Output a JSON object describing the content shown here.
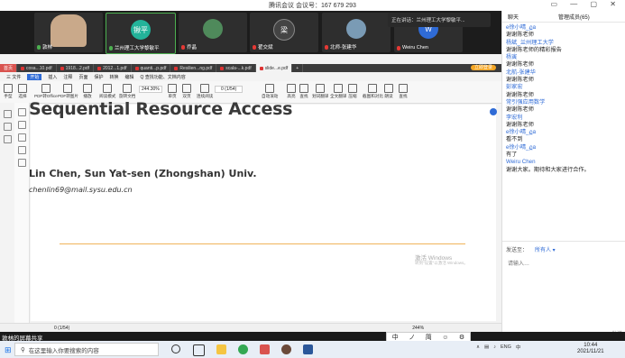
{
  "meeting": {
    "title": "腾讯会议 会议号：167 679 293",
    "speaking": "正在讲话：兰州理工大学黎敏平...",
    "participants": [
      {
        "name": "敦林",
        "avatar": "",
        "color": "#8a6b55"
      },
      {
        "name": "兰州理工大学黎敏平",
        "avatar": "锹平",
        "color": "#23b39a"
      },
      {
        "name": "乔晶",
        "avatar": "",
        "color": "#4f8a5b"
      },
      {
        "name": "翟交斌",
        "avatar": "梁",
        "color": "#444444"
      },
      {
        "name": "北师-张建华",
        "avatar": "",
        "color": "#7a9bb5"
      },
      {
        "name": "Weiru Chen",
        "avatar": "W",
        "color": "#2f6bd6"
      }
    ]
  },
  "chat": {
    "tab_chat": "聊天",
    "tab_manage": "管理成员(65)",
    "messages": [
      {
        "sender": "e徐小晴_ฏอ",
        "text": "谢谢陈老师"
      },
      {
        "sender": "杨斌_兰州理工大学",
        "text": "谢谢陈老师的精彩报告"
      },
      {
        "sender": "杨寅",
        "text": "谢谢陈老师"
      },
      {
        "sender": "北航-张建华",
        "text": "谢谢陈老师"
      },
      {
        "sender": "彭家宏",
        "text": "谢谢陈老师"
      },
      {
        "sender": "常引强应用数学",
        "text": "谢谢陈老师"
      },
      {
        "sender": "李宏利",
        "text": "谢谢陈老师"
      },
      {
        "sender": "e徐小晴_ฏอ",
        "text": "看不到"
      },
      {
        "sender": "e徐小晴_ฏอ",
        "text": "有了"
      },
      {
        "sender": "Weiru Chen",
        "text": "谢谢大家。期待和大家进行合作。"
      }
    ],
    "send_to_label": "发送至：",
    "send_to_value": "所有人 ▾",
    "input_placeholder": "请输入…",
    "send_label": "发送"
  },
  "wps": {
    "tabs": [
      "首页",
      "cosa...10.pdf",
      "1918...2.pdf",
      "2012...1.pdf",
      "quanti...p.pdf",
      "Resilien...ng.pdf",
      "scala-...k.pdf",
      "slide...e.pdf"
    ],
    "login": "立即登录",
    "menu": [
      "三 文件",
      "开始",
      "插入",
      "注释",
      "页面",
      "保护",
      "转换",
      "编辑",
      "Q 查找功能、文档内容"
    ],
    "tools": [
      "手型",
      "选择",
      "PDF转Office",
      "PDF转图片",
      "播放",
      "阅读模式",
      "旋转文档",
      "缩放",
      "单页",
      "双页",
      "连续阅读",
      "自动滚动",
      "高亮",
      "查找",
      "划词翻译",
      "全文翻译",
      "压缩",
      "截图和对比",
      "朗读",
      "查找"
    ],
    "zoom": "244.30%",
    "page": "0 (1/54)",
    "status_page": "0 (1/54)",
    "status_zoom": "244%"
  },
  "slide": {
    "title": "Sequential Resource Access",
    "authors": "Lin Chen, Sun Yat-sen (Zhongshan) Univ.",
    "email": "chenlin69@mail.sysu.edu.cn"
  },
  "watermark": {
    "line1": "激活 Windows",
    "line2": "转到\"设置\"以激活 Windows。"
  },
  "share": {
    "label": "敦林的屏幕共享",
    "ime": [
      "中",
      "ノ",
      "简",
      "☺",
      "⚙"
    ]
  },
  "taskbar": {
    "search_placeholder": "在这里输入你要搜索的内容",
    "tray": [
      "∧",
      "ENG",
      "中"
    ],
    "time": "10:44",
    "date": "2021/11/21"
  }
}
